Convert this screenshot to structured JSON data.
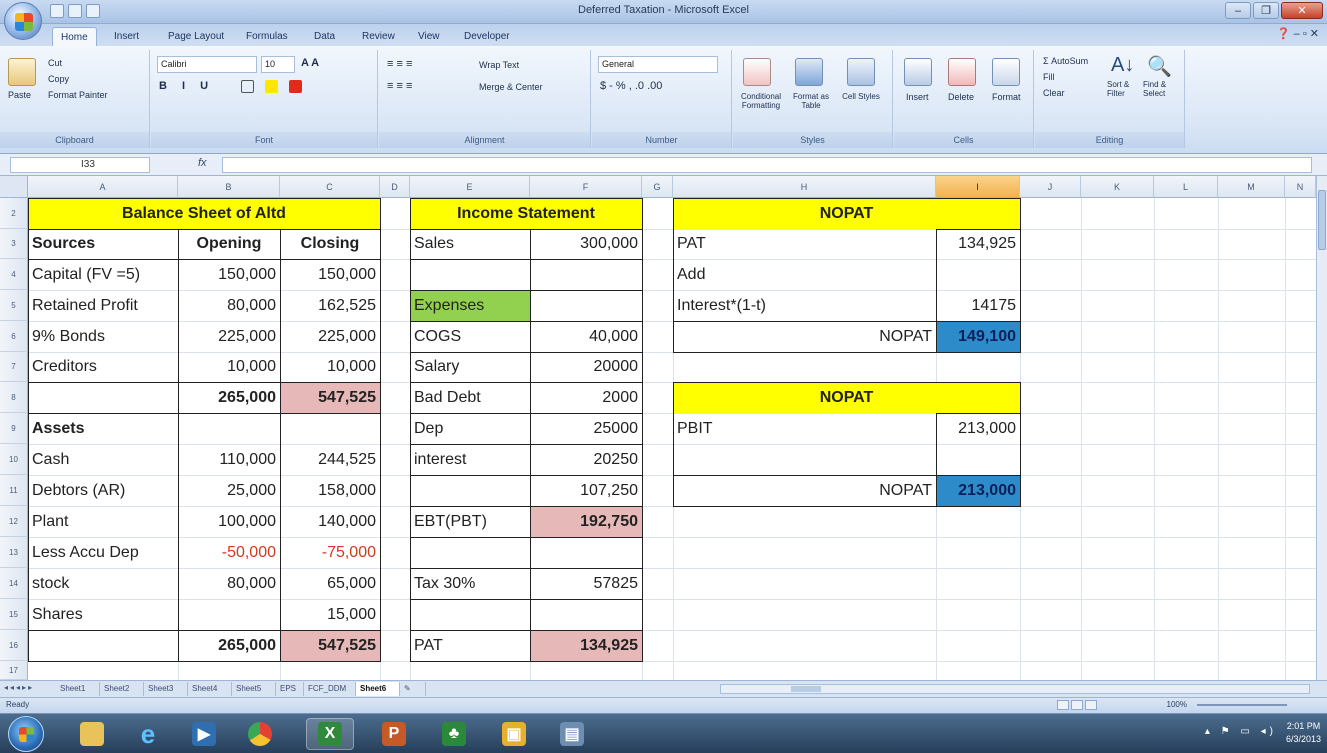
{
  "window": {
    "title": "Deferred Taxation - Microsoft Excel"
  },
  "ribbon": {
    "tabs": [
      "Home",
      "Insert",
      "Page Layout",
      "Formulas",
      "Data",
      "Review",
      "View",
      "Developer"
    ],
    "clipboard": {
      "paste": "Paste",
      "cut": "Cut",
      "copy": "Copy",
      "format_painter": "Format Painter",
      "label": "Clipboard"
    },
    "font": {
      "name": "Calibri",
      "size": "10",
      "label": "Font"
    },
    "alignment": {
      "wrap": "Wrap Text",
      "merge": "Merge & Center",
      "label": "Alignment"
    },
    "number": {
      "format": "General",
      "label": "Number"
    },
    "styles": {
      "conditional": "Conditional Formatting",
      "format_table": "Format as Table",
      "cell_styles": "Cell Styles",
      "label": "Styles"
    },
    "cells": {
      "insert": "Insert",
      "delete": "Delete",
      "format": "Format",
      "label": "Cells"
    },
    "editing": {
      "autosum": "AutoSum",
      "fill": "Fill",
      "clear": "Clear",
      "sort": "Sort & Filter",
      "find": "Find & Select",
      "label": "Editing"
    }
  },
  "formula_bar": {
    "name_box": "I33",
    "fx": "fx",
    "content": ""
  },
  "columns": [
    "A",
    "B",
    "C",
    "D",
    "E",
    "F",
    "G",
    "H",
    "I",
    "J",
    "K",
    "L",
    "M",
    "N"
  ],
  "rows": [
    "2",
    "3",
    "4",
    "5",
    "6",
    "7",
    "8",
    "9",
    "10",
    "11",
    "12",
    "13",
    "14",
    "15",
    "16",
    "17"
  ],
  "balance_sheet": {
    "title": "Balance Sheet of Altd",
    "headers": [
      "Sources",
      "Opening",
      "Closing"
    ],
    "sources": [
      [
        "Capital (FV =5)",
        "150,000",
        "150,000"
      ],
      [
        "Retained Profit",
        "80,000",
        "162,525"
      ],
      [
        "9% Bonds",
        "225,000",
        "225,000"
      ],
      [
        "Creditors",
        "10,000",
        "10,000"
      ]
    ],
    "sources_total": [
      "",
      "265,000",
      "547,525"
    ],
    "assets_label": "Assets",
    "assets": [
      [
        "Cash",
        "110,000",
        "244,525"
      ],
      [
        "Debtors (AR)",
        "25,000",
        "158,000"
      ],
      [
        "Plant",
        "100,000",
        "140,000"
      ],
      [
        "Less Accu Dep",
        "-50,000",
        "-75,000"
      ],
      [
        "stock",
        "80,000",
        "65,000"
      ],
      [
        "Shares",
        "",
        "15,000"
      ]
    ],
    "assets_total": [
      "",
      "265,000",
      "547,525"
    ]
  },
  "income_statement": {
    "title": "Income Statement",
    "rows": [
      [
        "Sales",
        "300,000"
      ],
      [
        "",
        ""
      ],
      [
        "Expenses",
        ""
      ],
      [
        "COGS",
        "40,000"
      ],
      [
        "Salary",
        "20000"
      ],
      [
        "Bad Debt",
        "2000"
      ],
      [
        "Dep",
        "25000"
      ],
      [
        "interest",
        "20250"
      ],
      [
        "",
        "107,250"
      ],
      [
        "EBT(PBT)",
        "192,750"
      ],
      [
        "",
        ""
      ],
      [
        "Tax 30%",
        "57825"
      ],
      [
        "",
        ""
      ],
      [
        "PAT",
        "134,925"
      ]
    ]
  },
  "nopat1": {
    "title": "NOPAT",
    "rows": [
      [
        "PAT",
        "134,925"
      ],
      [
        "Add",
        ""
      ],
      [
        "Interest*(1-t)",
        "14175"
      ]
    ],
    "result_label": "NOPAT",
    "result_value": "149,100"
  },
  "nopat2": {
    "title": "NOPAT",
    "rows": [
      [
        "PBIT",
        "213,000"
      ],
      [
        "",
        ""
      ]
    ],
    "result_label": "NOPAT",
    "result_value": "213,000"
  },
  "sheets": [
    "Sheet1",
    "Sheet2",
    "Sheet3",
    "Sheet4",
    "Sheet5",
    "EPS",
    "FCF_DDM",
    "Sheet6"
  ],
  "active_sheet": "Sheet6",
  "status": {
    "ready": "Ready",
    "zoom": "100%"
  },
  "taskbar": {
    "time": "2:01 PM",
    "date": "6/3/2013"
  },
  "colors": {
    "header_yellow": "#ffff00",
    "expenses_green": "#92d050",
    "total_pink": "#e6b8b7",
    "nopat_blue": "#2e8bc9",
    "negative_red": "#d13a1f"
  }
}
